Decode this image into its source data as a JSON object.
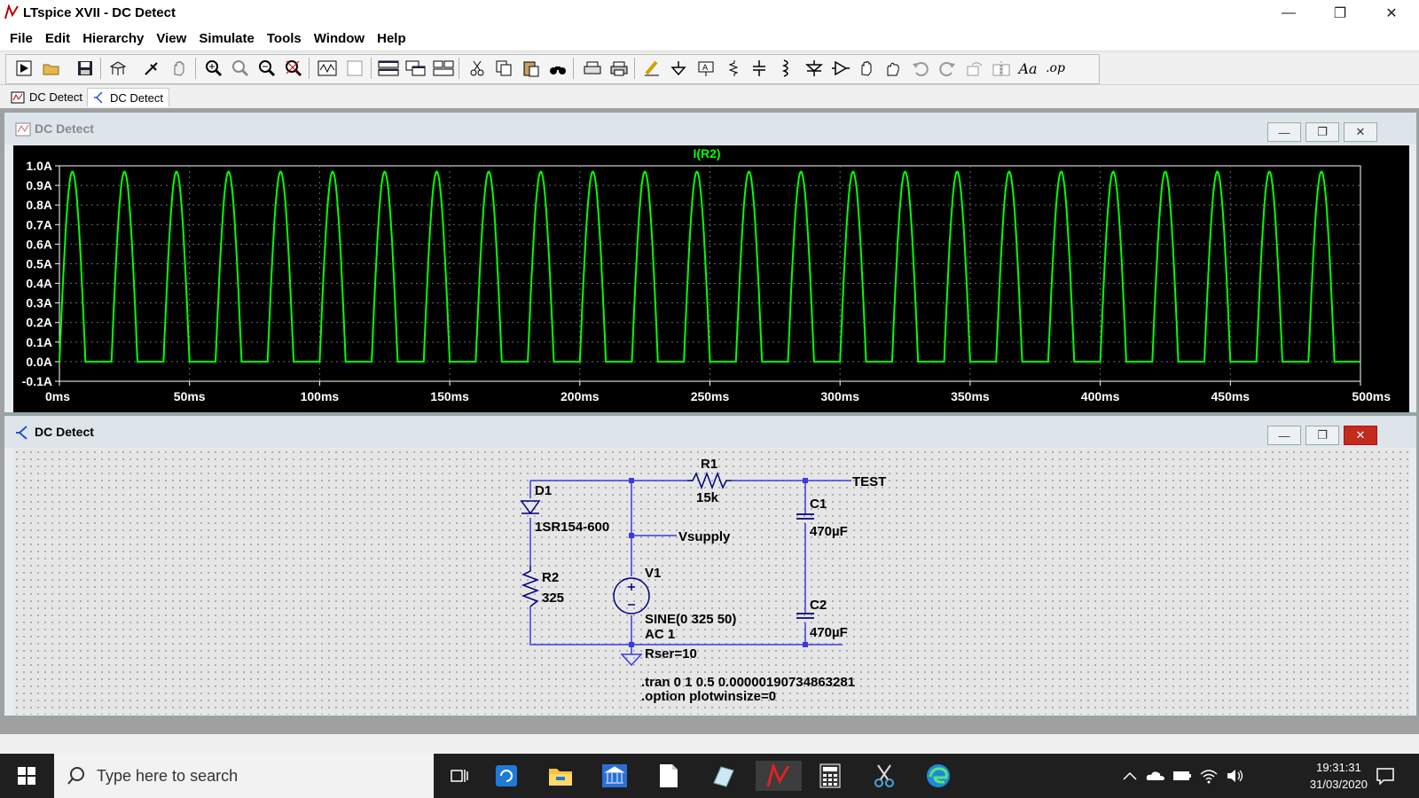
{
  "window": {
    "title": "LTspice XVII - DC Detect",
    "controls": {
      "minimize": "—",
      "maximize": "❐",
      "close": "✕"
    }
  },
  "menu": [
    "File",
    "Edit",
    "Hierarchy",
    "View",
    "Simulate",
    "Tools",
    "Window",
    "Help"
  ],
  "toolbar": {
    "icons": [
      "run-icon",
      "open-icon",
      "save-icon",
      "control-panel-icon",
      "run-pin-icon",
      "pan-icon",
      "zoom-in-icon",
      "zoom-pan-icon",
      "zoom-out-icon",
      "zoom-fit-icon",
      "waveform-icon",
      "blank-page-icon",
      "tile-horizontal-icon",
      "cascade-icon",
      "tile-icon",
      "cut-icon",
      "copy-icon",
      "paste-icon",
      "find-icon",
      "print-setup-icon",
      "print-icon",
      "draw-wire-icon",
      "ground-icon",
      "label-net-icon",
      "resistor-icon",
      "capacitor-icon",
      "inductor-icon",
      "diode-icon",
      "component-icon",
      "move-icon",
      "drag-icon",
      "undo-icon",
      "redo-icon",
      "rotate-icon",
      "mirror-icon",
      "text-icon",
      "spice-directive-icon"
    ],
    "text_tool": "Aa",
    "op_tool": ".op"
  },
  "tabs": [
    {
      "label": "DC Detect",
      "kind": "waveform"
    },
    {
      "label": "DC Detect",
      "kind": "schematic"
    }
  ],
  "waveform_window": {
    "title": "DC Detect",
    "trace_label": "I(R2)",
    "trace_color": "#00ff00",
    "y_ticks": [
      "1.0A",
      "0.9A",
      "0.8A",
      "0.7A",
      "0.6A",
      "0.5A",
      "0.4A",
      "0.3A",
      "0.2A",
      "0.1A",
      "0.0A",
      "-0.1A"
    ],
    "x_ticks": [
      "0ms",
      "50ms",
      "100ms",
      "150ms",
      "200ms",
      "250ms",
      "300ms",
      "350ms",
      "400ms",
      "450ms",
      "500ms"
    ]
  },
  "chart_data": {
    "type": "line",
    "series": [
      {
        "name": "I(R2)",
        "description_points": "half-wave rectified current, 25 pulses"
      }
    ],
    "x": {
      "range_ms": [
        0,
        500
      ]
    },
    "y": {
      "range_A": [
        -0.1,
        1.0
      ]
    },
    "pulse_count": 25,
    "pulse_period_ms": 20,
    "peak_A": 0.97,
    "first_peak_ms": 5,
    "grid": true
  },
  "schematic_window": {
    "title": "DC Detect",
    "labels": {
      "d1_name": "D1",
      "d1_value": "1SR154-600",
      "r1_name": "R1",
      "r1_value": "15k",
      "r2_name": "R2",
      "r2_value": "325",
      "c1_name": "C1",
      "c1_value": "470µF",
      "c2_name": "C2",
      "c2_value": "470µF",
      "v1_name": "V1",
      "v1_value": "SINE(0 325 50)",
      "v1_ac": "AC 1",
      "v1_rser": "Rser=10",
      "net_test": "TEST",
      "net_vsupply": "Vsupply",
      "directive_tran": ".tran 0 1 0.5 0.000001907348632​81",
      "directive_option": ".option plotwinsize=0"
    },
    "wire_color": "#3a3ae0",
    "component_color": "#000080"
  },
  "taskbar": {
    "search_placeholder": "Type here to search",
    "time": "19:31:31",
    "date": "31/03/2020",
    "apps": [
      "task-view-icon",
      "refresh-app-icon",
      "file-explorer-icon",
      "bank-icon",
      "document-icon",
      "notepad-icon",
      "ltspice-icon",
      "calculator-icon",
      "snipping-icon",
      "edge-icon"
    ],
    "tray": [
      "chevron-up-icon",
      "onedrive-icon",
      "battery-icon",
      "wifi-icon",
      "volume-icon"
    ]
  }
}
